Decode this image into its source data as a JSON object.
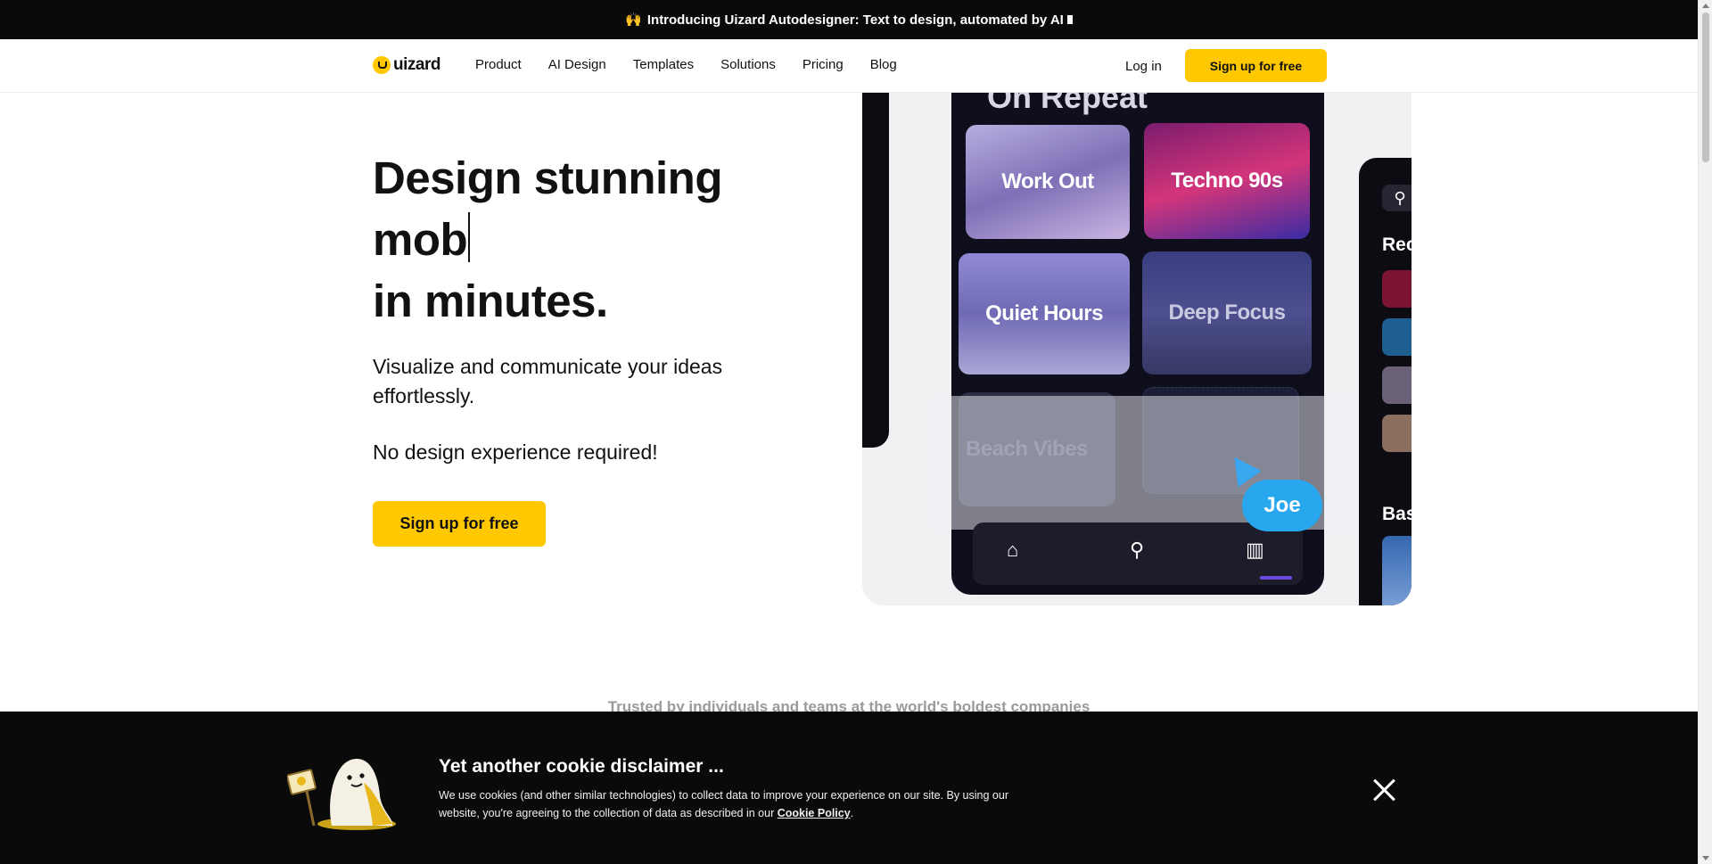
{
  "announcement": {
    "emoji": "🙌",
    "text": "Introducing Uizard Autodesigner: Text to design, automated by AI"
  },
  "nav": {
    "logo_text": "uizard",
    "links": [
      "Product",
      "AI Design",
      "Templates",
      "Solutions",
      "Pricing",
      "Blog"
    ],
    "login": "Log in",
    "signup": "Sign up for free"
  },
  "hero": {
    "title_line1": "Design stunning",
    "title_line2": "mob",
    "title_line3": "in minutes.",
    "subtitle": "Visualize and communicate your ideas effortlessly.",
    "subtitle2": "No design experience required!",
    "cta": "Sign up for free"
  },
  "mockup": {
    "header": "On Repeat",
    "tiles": [
      "Work Out",
      "Techno 90s",
      "Quiet Hours",
      "Deep Focus",
      "Beach Vibes"
    ],
    "cursor_label": "Joe",
    "right_labels": [
      "Rec",
      "Bas"
    ],
    "colors": {
      "accent_blue": "#28a7ee",
      "indicator": "#6b4ce0"
    }
  },
  "trusted": "Trusted by individuals and teams at the world's boldest companies",
  "cookie": {
    "title": "Yet another cookie disclaimer ...",
    "text": "We use cookies (and other similar technologies) to collect data to improve your experience on our site. By using our website, you're agreeing to the collection of data as described in our ",
    "link": "Cookie Policy",
    "suffix": "."
  },
  "colors": {
    "brand_yellow": "#ffc800",
    "dark": "#0a0a0a"
  }
}
